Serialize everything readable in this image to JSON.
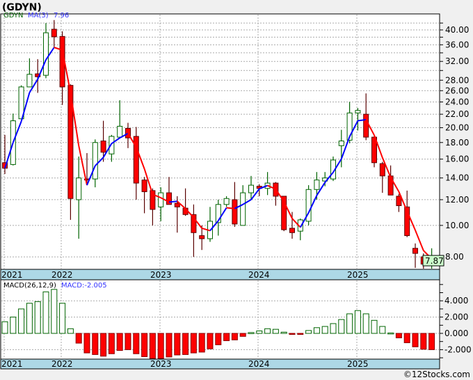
{
  "title": "(GDYN)",
  "legend": {
    "symbol": "GDYN",
    "ma_label": "MA(3)",
    "ma_value": "7.96"
  },
  "macd_legend": {
    "label": "MACD(26,12,9)",
    "value": "MACD:-2.005"
  },
  "last_price": "7.87",
  "footer": "©12Stocks.com",
  "colors": {
    "up": "#006400",
    "down": "#ff0000",
    "ma_up": "#0000ff",
    "ma_down": "#ff0000",
    "date_strip": "#add8e6",
    "last_price_bg": "#ccffcc"
  },
  "chart_data": [
    {
      "type": "candlestick",
      "title": "GDYN monthly price",
      "yscale": "log",
      "ylim": [
        7.2,
        43
      ],
      "year_labels": [
        "2021",
        "2022",
        "2023",
        "2024",
        "2025"
      ],
      "year_label_candle_index": [
        null,
        7,
        19,
        31,
        43
      ],
      "yticks": [
        "40.00",
        "36.00",
        "32.00",
        "28.00",
        "26.00",
        "24.00",
        "22.00",
        "20.00",
        "18.00",
        "16.00",
        "14.00",
        "12.00",
        "10.00",
        "8.00"
      ],
      "ytick_values": [
        40,
        36,
        32,
        28,
        26,
        24,
        22,
        20,
        18,
        16,
        14,
        12,
        10,
        8
      ],
      "grid_values": [
        42,
        40,
        38,
        36,
        34,
        32,
        30,
        28,
        26,
        24,
        22,
        20,
        18,
        16,
        14,
        12,
        10,
        8
      ],
      "ohlc": [
        [
          15.6,
          19.0,
          14.4,
          15.0
        ],
        [
          15.4,
          22.1,
          15.3,
          21.0
        ],
        [
          21.3,
          27.0,
          21.3,
          26.7
        ],
        [
          26.7,
          32.7,
          26.7,
          29.2
        ],
        [
          29.3,
          32.5,
          25.6,
          28.7
        ],
        [
          29.0,
          42.0,
          28.4,
          39.2
        ],
        [
          40.2,
          42.9,
          35.4,
          38.1
        ],
        [
          38.2,
          39.6,
          23.5,
          26.7
        ],
        [
          27.0,
          27.2,
          10.4,
          12.1
        ],
        [
          12.0,
          16.3,
          9.1,
          14.0
        ],
        [
          13.9,
          16.7,
          13.4,
          13.8
        ],
        [
          13.9,
          18.4,
          13.1,
          18.0
        ],
        [
          18.2,
          21.0,
          15.7,
          16.8
        ],
        [
          16.6,
          19.0,
          15.7,
          18.8
        ],
        [
          18.7,
          24.3,
          18.7,
          20.2
        ],
        [
          19.9,
          20.7,
          17.3,
          18.6
        ],
        [
          18.8,
          20.1,
          12.0,
          13.5
        ],
        [
          13.8,
          14.1,
          10.9,
          12.7
        ],
        [
          12.8,
          13.0,
          10.0,
          11.2
        ],
        [
          11.4,
          13.1,
          10.3,
          12.6
        ],
        [
          12.6,
          14.1,
          11.6,
          11.6
        ],
        [
          11.7,
          12.3,
          9.5,
          11.4
        ],
        [
          11.3,
          13.0,
          10.7,
          10.8
        ],
        [
          10.8,
          11.6,
          8.0,
          9.5
        ],
        [
          9.3,
          10.0,
          8.4,
          9.1
        ],
        [
          9.1,
          11.4,
          8.9,
          10.3
        ],
        [
          10.2,
          12.0,
          9.3,
          11.6
        ],
        [
          11.6,
          12.3,
          11.4,
          12.1
        ],
        [
          12.0,
          13.6,
          9.9,
          10.1
        ],
        [
          10.0,
          13.3,
          10.0,
          12.6
        ],
        [
          12.6,
          14.2,
          12.0,
          13.3
        ],
        [
          13.2,
          13.4,
          12.3,
          13.0
        ],
        [
          13.0,
          14.6,
          12.4,
          13.5
        ],
        [
          13.5,
          13.6,
          11.5,
          12.3
        ],
        [
          12.3,
          12.3,
          9.6,
          9.7
        ],
        [
          9.8,
          11.0,
          9.1,
          9.5
        ],
        [
          9.6,
          10.5,
          9.0,
          10.4
        ],
        [
          10.3,
          13.3,
          10.0,
          12.9
        ],
        [
          12.9,
          14.6,
          12.0,
          13.8
        ],
        [
          13.7,
          14.6,
          13.2,
          14.0
        ],
        [
          13.9,
          16.3,
          13.7,
          15.9
        ],
        [
          17.6,
          19.7,
          15.1,
          18.2
        ],
        [
          18.3,
          24.0,
          17.9,
          22.2
        ],
        [
          22.2,
          23.0,
          19.6,
          22.6
        ],
        [
          22.0,
          25.5,
          18.3,
          18.7
        ],
        [
          18.7,
          18.8,
          15.1,
          15.6
        ],
        [
          15.5,
          15.7,
          12.6,
          14.2
        ],
        [
          14.2,
          15.3,
          12.4,
          12.4
        ],
        [
          12.3,
          12.5,
          11.0,
          11.5
        ],
        [
          11.4,
          12.8,
          9.2,
          9.3
        ],
        [
          8.5,
          8.8,
          7.4,
          8.2
        ],
        [
          8.0,
          8.2,
          7.3,
          7.6
        ],
        [
          7.6,
          8.5,
          7.3,
          7.87
        ]
      ]
    },
    {
      "type": "bar",
      "title": "MACD(26,12,9) histogram",
      "ylim": [
        -3.1,
        6.5
      ],
      "yticks": [
        "4.000",
        "2.000",
        "0.000",
        "-2.000"
      ],
      "ytick_values": [
        4,
        2,
        0,
        -2
      ],
      "values": [
        1.43,
        2.0,
        3.0,
        3.7,
        3.9,
        5.1,
        5.4,
        3.7,
        0.57,
        -1.2,
        -2.4,
        -2.6,
        -2.8,
        -2.5,
        -2.1,
        -2.0,
        -2.5,
        -2.86,
        -3.2,
        -3.1,
        -2.9,
        -2.65,
        -2.6,
        -2.4,
        -2.3,
        -1.9,
        -1.4,
        -0.9,
        -0.8,
        -0.37,
        0.1,
        0.3,
        0.57,
        0.5,
        0.15,
        -0.03,
        -0.03,
        0.35,
        0.7,
        0.85,
        1.2,
        1.7,
        2.4,
        2.8,
        2.4,
        1.6,
        0.85,
        0.05,
        -0.55,
        -1.15,
        -1.65,
        -1.95,
        -2.0
      ]
    }
  ]
}
